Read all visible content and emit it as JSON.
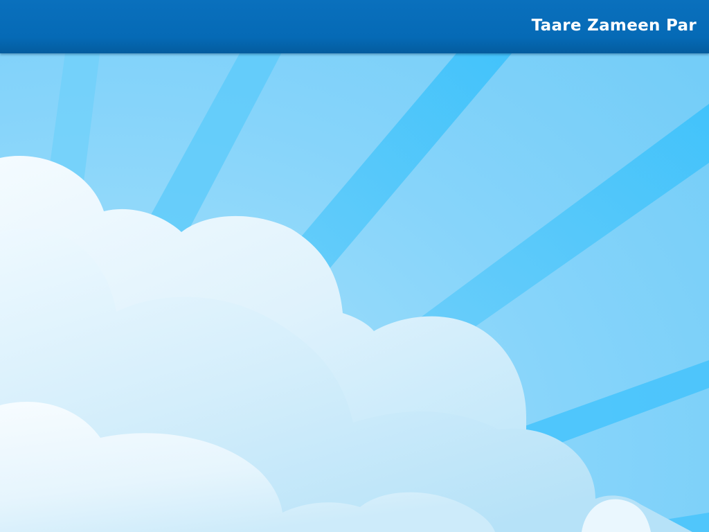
{
  "header": {
    "title": "Taare Zameen Par"
  },
  "colors": {
    "header_bar": "#0570BB",
    "title_text": "#FFFFFF",
    "sky_light": "#86D4FA",
    "sky_ray": "#44C4FB",
    "cloud_white": "#F4FAFE",
    "cloud_shadow": "#B9E3F8"
  }
}
